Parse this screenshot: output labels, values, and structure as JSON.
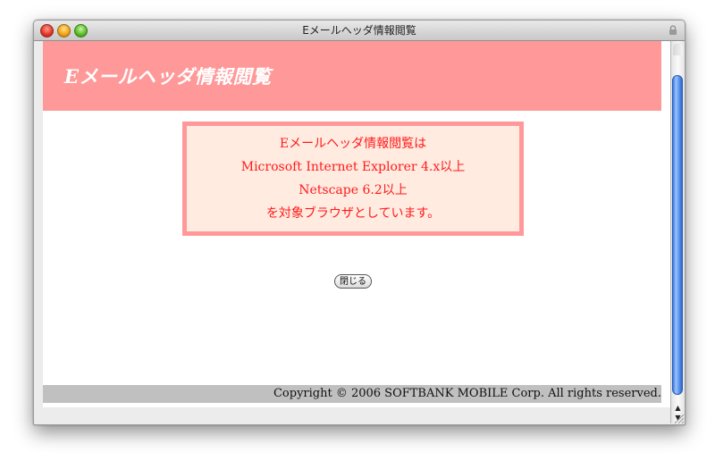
{
  "window": {
    "title": "Eメールヘッダ情報閲覧"
  },
  "page": {
    "title": "Eメールヘッダ情報閲覧",
    "notice_lines": [
      "Eメールヘッダ情報閲覧は",
      "Microsoft Internet Explorer 4.x以上",
      "Netscape 6.2以上",
      "を対象ブラウザとしています。"
    ],
    "close_button_label": "閉じる",
    "copyright": "Copyright © 2006 SOFTBANK MOBILE Corp. All rights reserved."
  },
  "scrollbar": {
    "up_arrow": "▲",
    "down_arrow": "▼"
  },
  "colors": {
    "header_band": "#ff9999",
    "notice_border": "#ff9999",
    "notice_background": "#ffebe0",
    "notice_text": "#ff1a1a",
    "footer_band": "#c0c0c0"
  },
  "icons": [
    "close-window-icon",
    "minimize-window-icon",
    "zoom-window-icon",
    "lock-icon",
    "resize-grip-icon"
  ]
}
